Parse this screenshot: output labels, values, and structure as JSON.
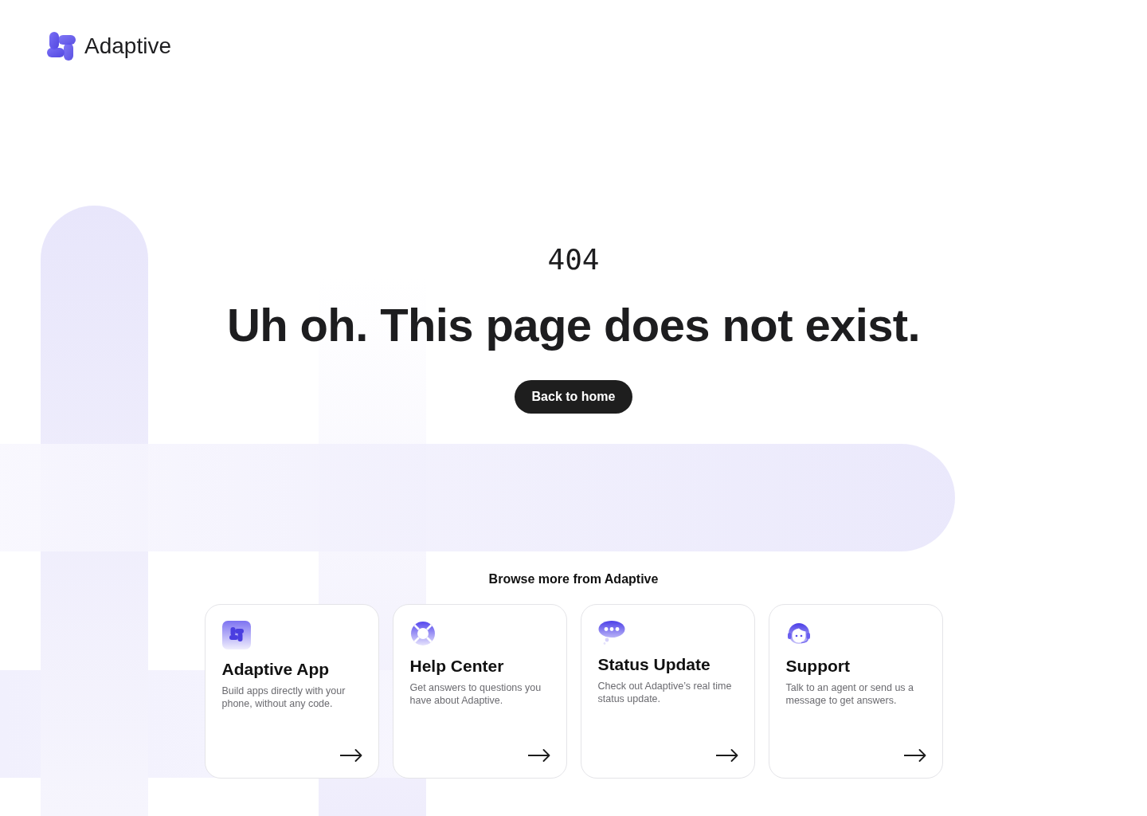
{
  "header": {
    "brand": "Adaptive"
  },
  "error": {
    "code": "404",
    "heading": "Uh oh. This page does not exist.",
    "button": "Back to home"
  },
  "browse": {
    "title": "Browse more from Adaptive",
    "cards": [
      {
        "kind": "app",
        "title": "Adaptive App",
        "description": "Build apps directly with your phone, without any code."
      },
      {
        "kind": "help",
        "title": "Help Center",
        "description": "Get answers to questions you have about Adaptive."
      },
      {
        "kind": "status",
        "title": "Status Update",
        "description": "Check out Adaptive’s real time status update."
      },
      {
        "kind": "support",
        "title": "Support",
        "description": "Talk to an agent or send us a message to get answers."
      }
    ]
  }
}
